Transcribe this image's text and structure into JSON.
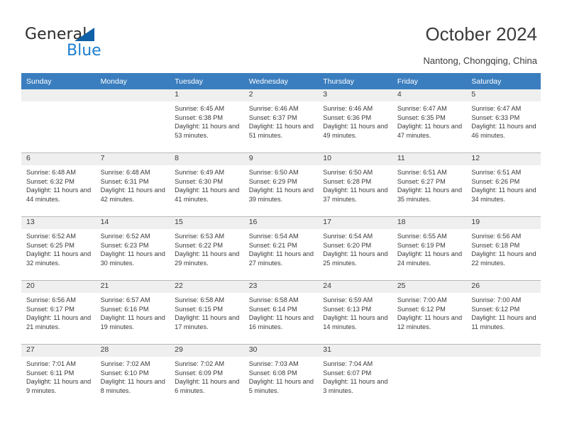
{
  "brand": {
    "name_part1": "General",
    "name_part2": "Blue",
    "triangle_icon": "triangle-icon",
    "accent_blue": "#1d7fd0",
    "logo_triangle_blue": "#1060a8"
  },
  "header": {
    "title": "October 2024",
    "subtitle": "Nantong, Chongqing, China",
    "header_row_bg": "#3b7ebf",
    "daynum_band_bg": "#efefef"
  },
  "calendar": {
    "weekday_headers": [
      "Sunday",
      "Monday",
      "Tuesday",
      "Wednesday",
      "Thursday",
      "Friday",
      "Saturday"
    ],
    "labels": {
      "sunrise": "Sunrise:",
      "sunset": "Sunset:",
      "daylight": "Daylight:"
    },
    "weeks": [
      [
        {
          "day": "",
          "empty": true
        },
        {
          "day": "",
          "empty": true
        },
        {
          "day": "1",
          "sunrise": "Sunrise: 6:45 AM",
          "sunset": "Sunset: 6:38 PM",
          "daylight": "Daylight: 11 hours and 53 minutes."
        },
        {
          "day": "2",
          "sunrise": "Sunrise: 6:46 AM",
          "sunset": "Sunset: 6:37 PM",
          "daylight": "Daylight: 11 hours and 51 minutes."
        },
        {
          "day": "3",
          "sunrise": "Sunrise: 6:46 AM",
          "sunset": "Sunset: 6:36 PM",
          "daylight": "Daylight: 11 hours and 49 minutes."
        },
        {
          "day": "4",
          "sunrise": "Sunrise: 6:47 AM",
          "sunset": "Sunset: 6:35 PM",
          "daylight": "Daylight: 11 hours and 47 minutes."
        },
        {
          "day": "5",
          "sunrise": "Sunrise: 6:47 AM",
          "sunset": "Sunset: 6:33 PM",
          "daylight": "Daylight: 11 hours and 46 minutes."
        }
      ],
      [
        {
          "day": "6",
          "sunrise": "Sunrise: 6:48 AM",
          "sunset": "Sunset: 6:32 PM",
          "daylight": "Daylight: 11 hours and 44 minutes."
        },
        {
          "day": "7",
          "sunrise": "Sunrise: 6:48 AM",
          "sunset": "Sunset: 6:31 PM",
          "daylight": "Daylight: 11 hours and 42 minutes."
        },
        {
          "day": "8",
          "sunrise": "Sunrise: 6:49 AM",
          "sunset": "Sunset: 6:30 PM",
          "daylight": "Daylight: 11 hours and 41 minutes."
        },
        {
          "day": "9",
          "sunrise": "Sunrise: 6:50 AM",
          "sunset": "Sunset: 6:29 PM",
          "daylight": "Daylight: 11 hours and 39 minutes."
        },
        {
          "day": "10",
          "sunrise": "Sunrise: 6:50 AM",
          "sunset": "Sunset: 6:28 PM",
          "daylight": "Daylight: 11 hours and 37 minutes."
        },
        {
          "day": "11",
          "sunrise": "Sunrise: 6:51 AM",
          "sunset": "Sunset: 6:27 PM",
          "daylight": "Daylight: 11 hours and 35 minutes."
        },
        {
          "day": "12",
          "sunrise": "Sunrise: 6:51 AM",
          "sunset": "Sunset: 6:26 PM",
          "daylight": "Daylight: 11 hours and 34 minutes."
        }
      ],
      [
        {
          "day": "13",
          "sunrise": "Sunrise: 6:52 AM",
          "sunset": "Sunset: 6:25 PM",
          "daylight": "Daylight: 11 hours and 32 minutes."
        },
        {
          "day": "14",
          "sunrise": "Sunrise: 6:52 AM",
          "sunset": "Sunset: 6:23 PM",
          "daylight": "Daylight: 11 hours and 30 minutes."
        },
        {
          "day": "15",
          "sunrise": "Sunrise: 6:53 AM",
          "sunset": "Sunset: 6:22 PM",
          "daylight": "Daylight: 11 hours and 29 minutes."
        },
        {
          "day": "16",
          "sunrise": "Sunrise: 6:54 AM",
          "sunset": "Sunset: 6:21 PM",
          "daylight": "Daylight: 11 hours and 27 minutes."
        },
        {
          "day": "17",
          "sunrise": "Sunrise: 6:54 AM",
          "sunset": "Sunset: 6:20 PM",
          "daylight": "Daylight: 11 hours and 25 minutes."
        },
        {
          "day": "18",
          "sunrise": "Sunrise: 6:55 AM",
          "sunset": "Sunset: 6:19 PM",
          "daylight": "Daylight: 11 hours and 24 minutes."
        },
        {
          "day": "19",
          "sunrise": "Sunrise: 6:56 AM",
          "sunset": "Sunset: 6:18 PM",
          "daylight": "Daylight: 11 hours and 22 minutes."
        }
      ],
      [
        {
          "day": "20",
          "sunrise": "Sunrise: 6:56 AM",
          "sunset": "Sunset: 6:17 PM",
          "daylight": "Daylight: 11 hours and 21 minutes."
        },
        {
          "day": "21",
          "sunrise": "Sunrise: 6:57 AM",
          "sunset": "Sunset: 6:16 PM",
          "daylight": "Daylight: 11 hours and 19 minutes."
        },
        {
          "day": "22",
          "sunrise": "Sunrise: 6:58 AM",
          "sunset": "Sunset: 6:15 PM",
          "daylight": "Daylight: 11 hours and 17 minutes."
        },
        {
          "day": "23",
          "sunrise": "Sunrise: 6:58 AM",
          "sunset": "Sunset: 6:14 PM",
          "daylight": "Daylight: 11 hours and 16 minutes."
        },
        {
          "day": "24",
          "sunrise": "Sunrise: 6:59 AM",
          "sunset": "Sunset: 6:13 PM",
          "daylight": "Daylight: 11 hours and 14 minutes."
        },
        {
          "day": "25",
          "sunrise": "Sunrise: 7:00 AM",
          "sunset": "Sunset: 6:12 PM",
          "daylight": "Daylight: 11 hours and 12 minutes."
        },
        {
          "day": "26",
          "sunrise": "Sunrise: 7:00 AM",
          "sunset": "Sunset: 6:12 PM",
          "daylight": "Daylight: 11 hours and 11 minutes."
        }
      ],
      [
        {
          "day": "27",
          "sunrise": "Sunrise: 7:01 AM",
          "sunset": "Sunset: 6:11 PM",
          "daylight": "Daylight: 11 hours and 9 minutes."
        },
        {
          "day": "28",
          "sunrise": "Sunrise: 7:02 AM",
          "sunset": "Sunset: 6:10 PM",
          "daylight": "Daylight: 11 hours and 8 minutes."
        },
        {
          "day": "29",
          "sunrise": "Sunrise: 7:02 AM",
          "sunset": "Sunset: 6:09 PM",
          "daylight": "Daylight: 11 hours and 6 minutes."
        },
        {
          "day": "30",
          "sunrise": "Sunrise: 7:03 AM",
          "sunset": "Sunset: 6:08 PM",
          "daylight": "Daylight: 11 hours and 5 minutes."
        },
        {
          "day": "31",
          "sunrise": "Sunrise: 7:04 AM",
          "sunset": "Sunset: 6:07 PM",
          "daylight": "Daylight: 11 hours and 3 minutes."
        },
        {
          "day": "",
          "empty": true
        },
        {
          "day": "",
          "empty": true
        }
      ]
    ]
  }
}
